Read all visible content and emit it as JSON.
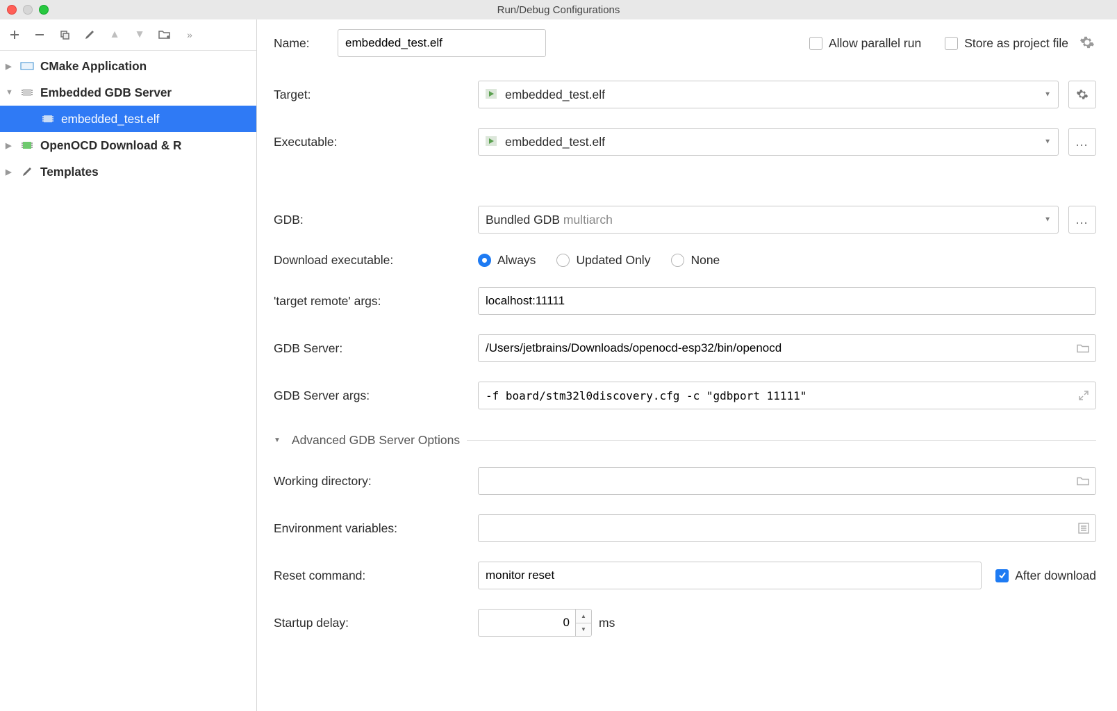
{
  "window": {
    "title": "Run/Debug Configurations"
  },
  "tree": {
    "items": [
      {
        "label": "CMake Application",
        "expandable": true,
        "expanded": false
      },
      {
        "label": "Embedded GDB Server",
        "expandable": true,
        "expanded": true
      },
      {
        "label": "embedded_test.elf",
        "child": true,
        "selected": true
      },
      {
        "label": "OpenOCD Download & Run",
        "expandable": true,
        "expanded": false,
        "truncated": "OpenOCD Download & R"
      },
      {
        "label": "Templates",
        "expandable": true,
        "expanded": false
      }
    ]
  },
  "form": {
    "name_label": "Name:",
    "name_value": "embedded_test.elf",
    "allow_parallel": "Allow parallel run",
    "store_project": "Store as project file",
    "target_label": "Target:",
    "target_value": "embedded_test.elf",
    "executable_label": "Executable:",
    "executable_value": "embedded_test.elf",
    "gdb_label": "GDB:",
    "gdb_value_prefix": "Bundled GDB ",
    "gdb_value_muted": "multiarch",
    "download_exec_label": "Download executable:",
    "download_exec_options": [
      "Always",
      "Updated Only",
      "None"
    ],
    "download_exec_selected": "Always",
    "target_remote_label": "'target remote' args:",
    "target_remote_value": "localhost:11111",
    "gdb_server_label": "GDB Server:",
    "gdb_server_value": "/Users/jetbrains/Downloads/openocd-esp32/bin/openocd",
    "gdb_server_args_label": "GDB Server args:",
    "gdb_server_args_value": "-f board/stm32l0discovery.cfg -c \"gdbport 11111\"",
    "advanced_label": "Advanced GDB Server Options",
    "working_dir_label": "Working directory:",
    "working_dir_value": "",
    "env_vars_label": "Environment variables:",
    "env_vars_value": "",
    "reset_label": "Reset command:",
    "reset_value": "monitor reset",
    "after_download_label": "After download",
    "startup_delay_label": "Startup delay:",
    "startup_delay_value": "0",
    "startup_delay_unit": "ms"
  }
}
